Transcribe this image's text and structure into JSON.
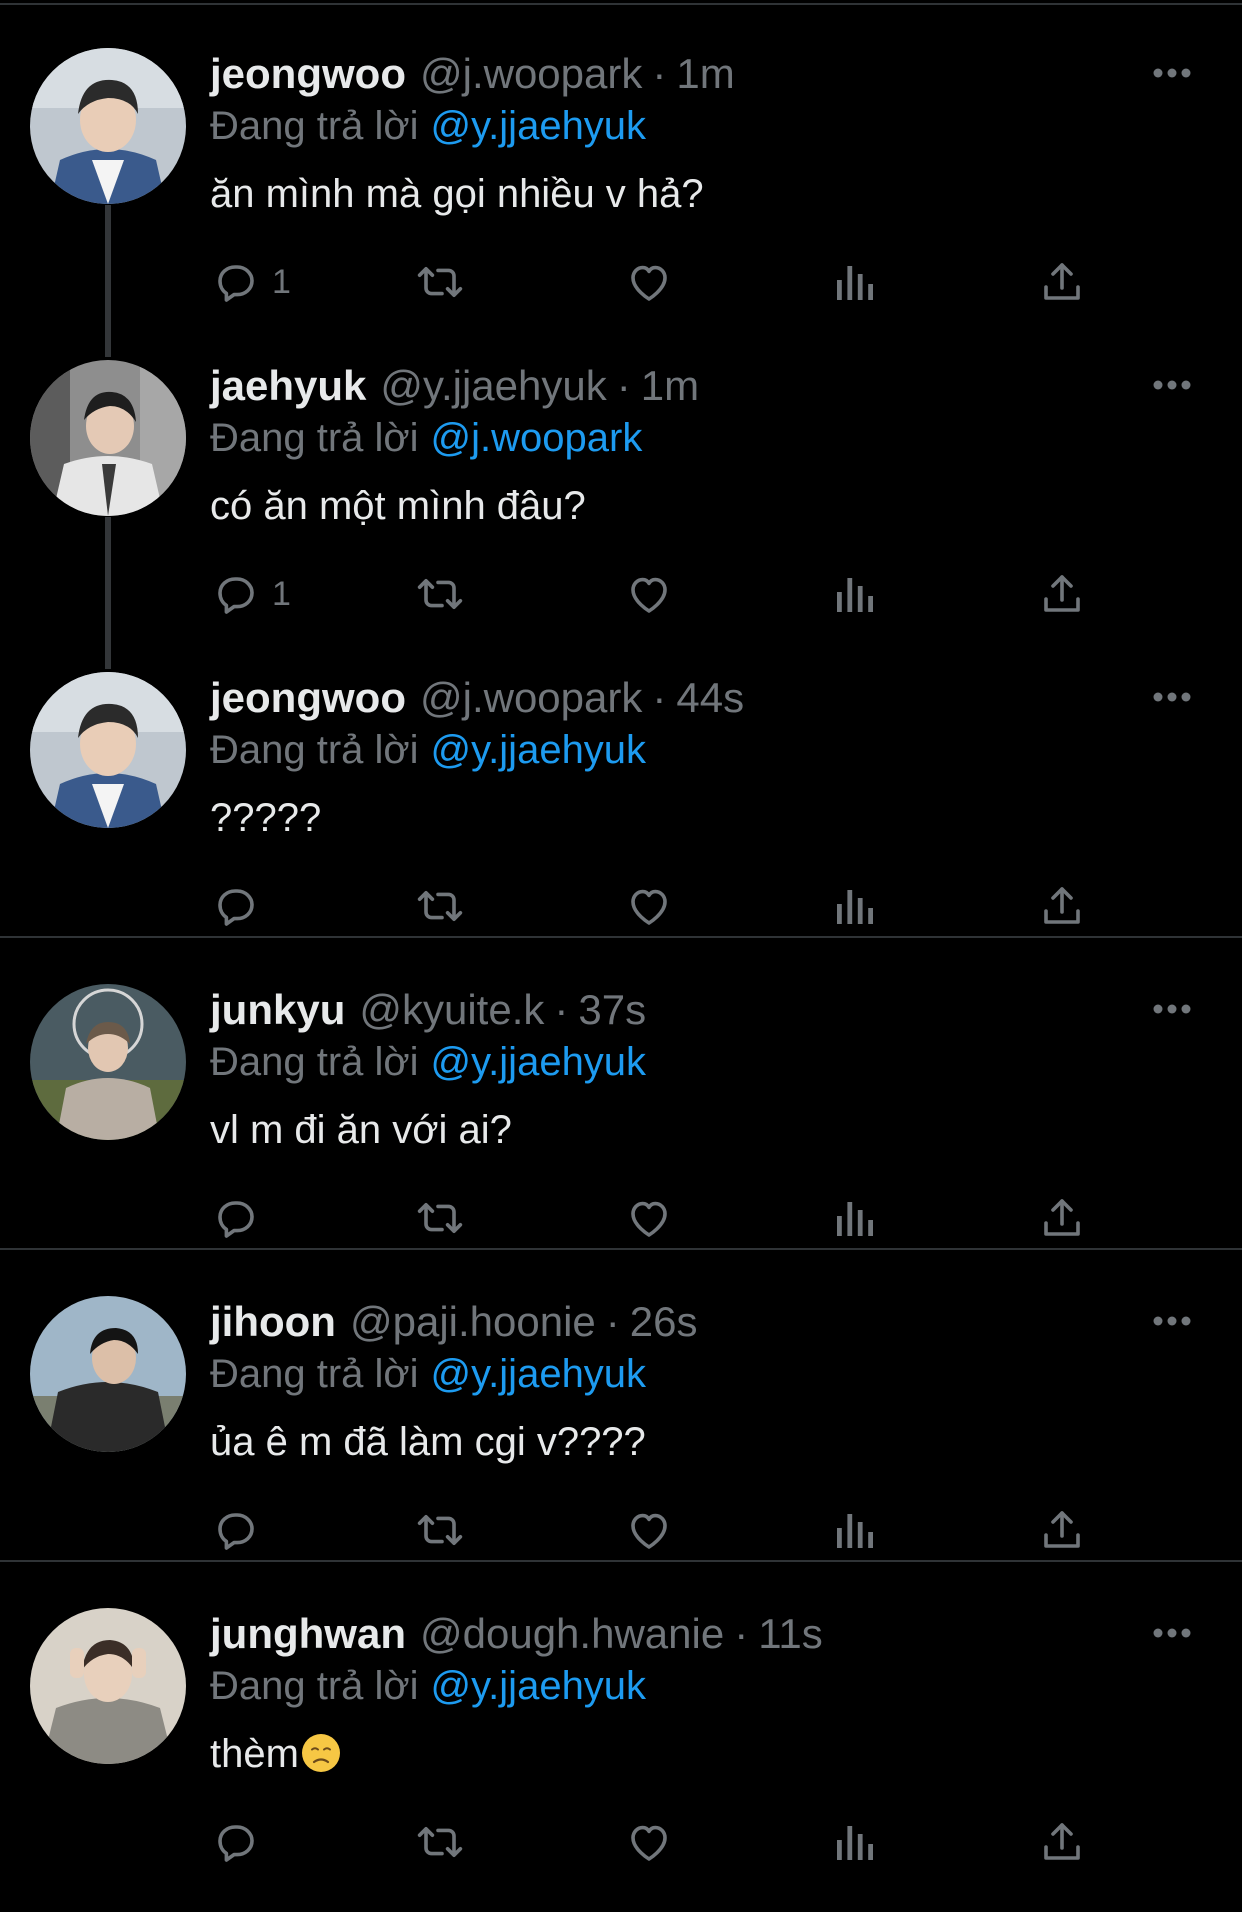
{
  "replying_label": "Đang trả lời",
  "tweets": [
    {
      "name": "jeongwoo",
      "handle": "@j.woopark",
      "time": "1m",
      "reply_to": "@y.jjaehyuk",
      "text": "ăn mình mà gọi nhiều v hả?",
      "reply_count": "1",
      "avatar": "avatar-jeongwoo"
    },
    {
      "name": "jaehyuk",
      "handle": "@y.jjaehyuk",
      "time": "1m",
      "reply_to": "@j.woopark",
      "text": "có ăn một mình đâu?",
      "reply_count": "1",
      "avatar": "avatar-jaehyuk"
    },
    {
      "name": "jeongwoo",
      "handle": "@j.woopark",
      "time": "44s",
      "reply_to": "@y.jjaehyuk",
      "text": "?????",
      "reply_count": "",
      "avatar": "avatar-jeongwoo"
    },
    {
      "name": "junkyu",
      "handle": "@kyuite.k",
      "time": "37s",
      "reply_to": "@y.jjaehyuk",
      "text": "vl m đi ăn với ai?",
      "reply_count": "",
      "avatar": "avatar-junkyu"
    },
    {
      "name": "jihoon",
      "handle": "@paji.hoonie",
      "time": "26s",
      "reply_to": "@y.jjaehyuk",
      "text": "ủa ê m đã làm cgi v????",
      "reply_count": "",
      "avatar": "avatar-jihoon"
    },
    {
      "name": "junghwan",
      "handle": "@dough.hwanie",
      "time": "11s",
      "reply_to": "@y.jjaehyuk",
      "text": "thèm",
      "reply_count": "",
      "emoji": "disappointed-face-emoji",
      "avatar": "avatar-junghwan"
    }
  ],
  "colors": {
    "background": "#000000",
    "text_primary": "#e7e9ea",
    "text_secondary": "#71767b",
    "link": "#1d9bf0",
    "divider": "#2f3336",
    "thread_line": "#333639"
  }
}
